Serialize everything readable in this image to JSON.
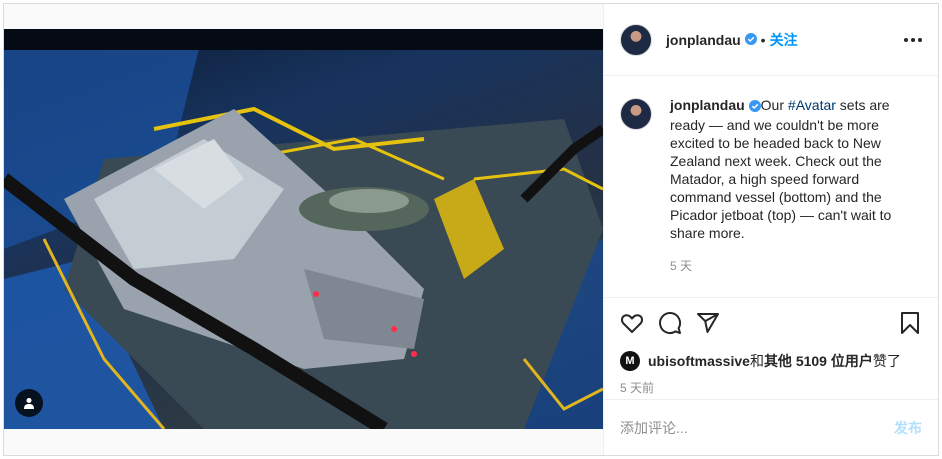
{
  "post": {
    "username": "jonplandau",
    "verified": true,
    "follow_label": "关注",
    "dot": "•",
    "more_icon": "more-options-icon"
  },
  "caption": {
    "username": "jonplandau",
    "text_before": "Our ",
    "hashtag": "#Avatar",
    "text_after": " sets are ready — and we couldn't be more excited to be headed back to New Zealand next week. Check out the Matador, a high speed forward command vessel (bottom) and the Picador jetboat (top) — can't wait to share more.",
    "time": "5 天"
  },
  "actions": {
    "like_icon": "heart-icon",
    "comment_icon": "comment-icon",
    "share_icon": "share-icon",
    "save_icon": "bookmark-icon"
  },
  "likes": {
    "liker": "ubisoftmassive",
    "and_text": " 和 ",
    "others": "其他 5109 位用户",
    "liked_text": " 赞了"
  },
  "date": "5 天前",
  "comment_box": {
    "placeholder": "添加评论...",
    "post_label": "发布"
  },
  "colors": {
    "accent": "#0095f6",
    "post_disabled": "#b2dffc",
    "hashtag": "#00376b",
    "muted": "#8e8e8e"
  }
}
